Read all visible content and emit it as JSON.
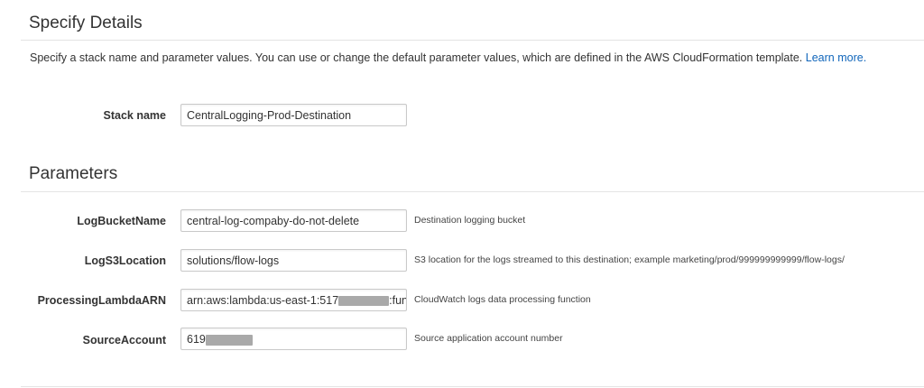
{
  "specify_details": {
    "title": "Specify Details",
    "description": "Specify a stack name and parameter values. You can use or change the default parameter values, which are defined in the AWS CloudFormation template.",
    "learn_more": "Learn more.",
    "stack_name_label": "Stack name",
    "stack_name_value": "CentralLogging-Prod-Destination"
  },
  "parameters": {
    "title": "Parameters",
    "items": [
      {
        "label": "LogBucketName",
        "value": "central-log-compaby-do-not-delete",
        "help": "Destination logging bucket"
      },
      {
        "label": "LogS3Location",
        "value": "solutions/flow-logs",
        "help": "S3 location for the logs streamed to this destination; example marketing/prod/999999999999/flow-logs/"
      },
      {
        "label": "ProcessingLambdaARN",
        "value_prefix": "arn:aws:lambda:us-east-1:517",
        "value_suffix": ":func",
        "help": "CloudWatch logs data processing function"
      },
      {
        "label": "SourceAccount",
        "value_prefix": "619",
        "help": "Source application account number"
      }
    ]
  }
}
